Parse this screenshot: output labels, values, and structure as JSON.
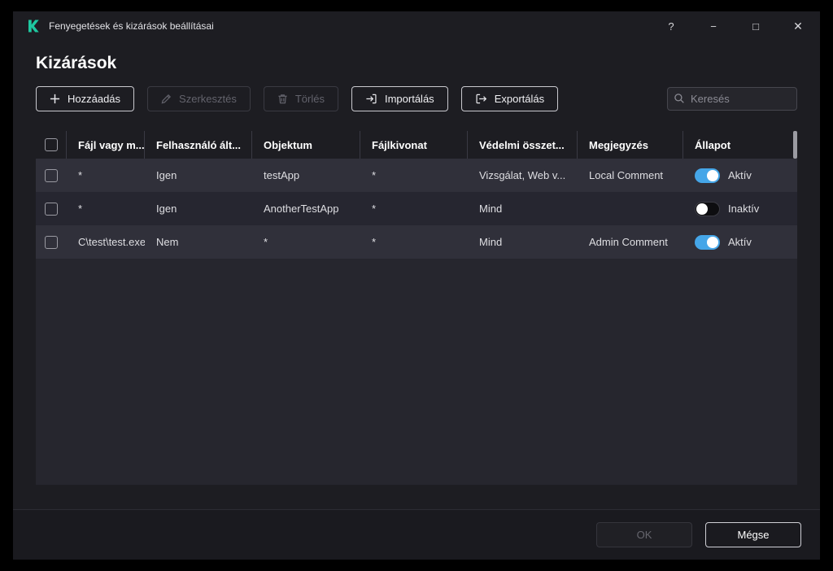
{
  "window": {
    "title": "Fenyegetések és kizárások beállításai",
    "controls": {
      "help": "?",
      "minimize": "−",
      "maximize": "□",
      "close": "✕"
    }
  },
  "page": {
    "title": "Kizárások"
  },
  "toolbar": {
    "add": "Hozzáadás",
    "edit": "Szerkesztés",
    "delete": "Törlés",
    "import": "Importálás",
    "export": "Exportálás",
    "search_placeholder": "Keresés"
  },
  "table": {
    "headers": {
      "path": "Fájl vagy m...",
      "user": "Felhasználó ált...",
      "object": "Objektum",
      "hash": "Fájlkivonat",
      "components": "Védelmi összet...",
      "comment": "Megjegyzés",
      "status": "Állapot"
    },
    "rows": [
      {
        "path": "*",
        "user": "Igen",
        "object": "testApp",
        "hash": "*",
        "components": "Vizsgálat, Web v...",
        "comment": "Local Comment",
        "status": "Aktív",
        "enabled": true
      },
      {
        "path": "*",
        "user": "Igen",
        "object": "AnotherTestApp",
        "hash": "*",
        "components": "Mind",
        "comment": "",
        "status": "Inaktív",
        "enabled": false
      },
      {
        "path": "C\\test\\test.exe",
        "user": "Nem",
        "object": "*",
        "hash": "*",
        "components": "Mind",
        "comment": "Admin Comment",
        "status": "Aktív",
        "enabled": true
      }
    ]
  },
  "footer": {
    "ok": "OK",
    "cancel": "Mégse"
  },
  "colors": {
    "logo_green": "#1ec8a0",
    "toggle_on": "#45a6e8"
  }
}
